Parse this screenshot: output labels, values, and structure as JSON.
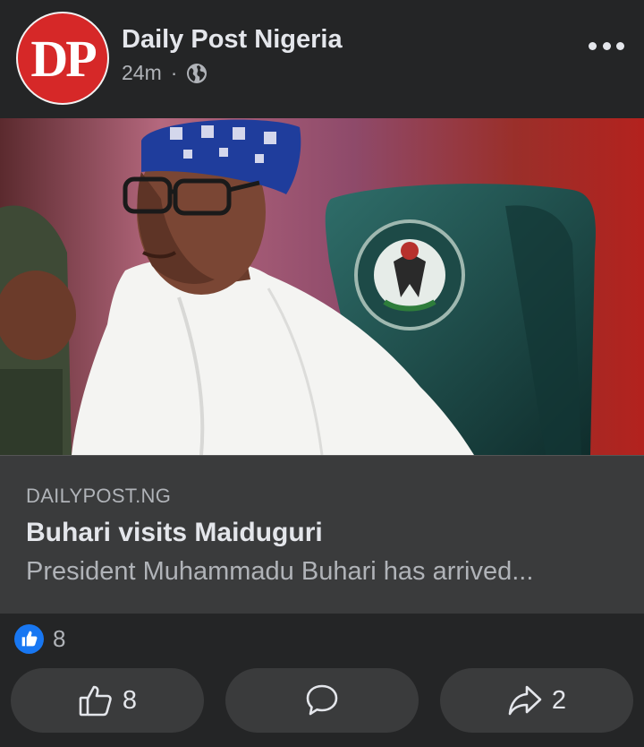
{
  "post": {
    "page_name": "Daily Post Nigeria",
    "avatar_text": "DP",
    "time": "24m",
    "separator": "·",
    "privacy_icon": "globe-icon"
  },
  "link_preview": {
    "domain": "DAILYPOST.NG",
    "headline": "Buhari visits Maiduguri",
    "description": "President Muhammadu Buhari has arrived..."
  },
  "reactions": {
    "icon": "like-icon",
    "count": "8"
  },
  "actions": {
    "like_count": "8",
    "share_count": "2"
  },
  "colors": {
    "background": "#242526",
    "button_bg": "#3a3b3c",
    "avatar_red": "#d62828",
    "like_blue": "#1877f2"
  }
}
